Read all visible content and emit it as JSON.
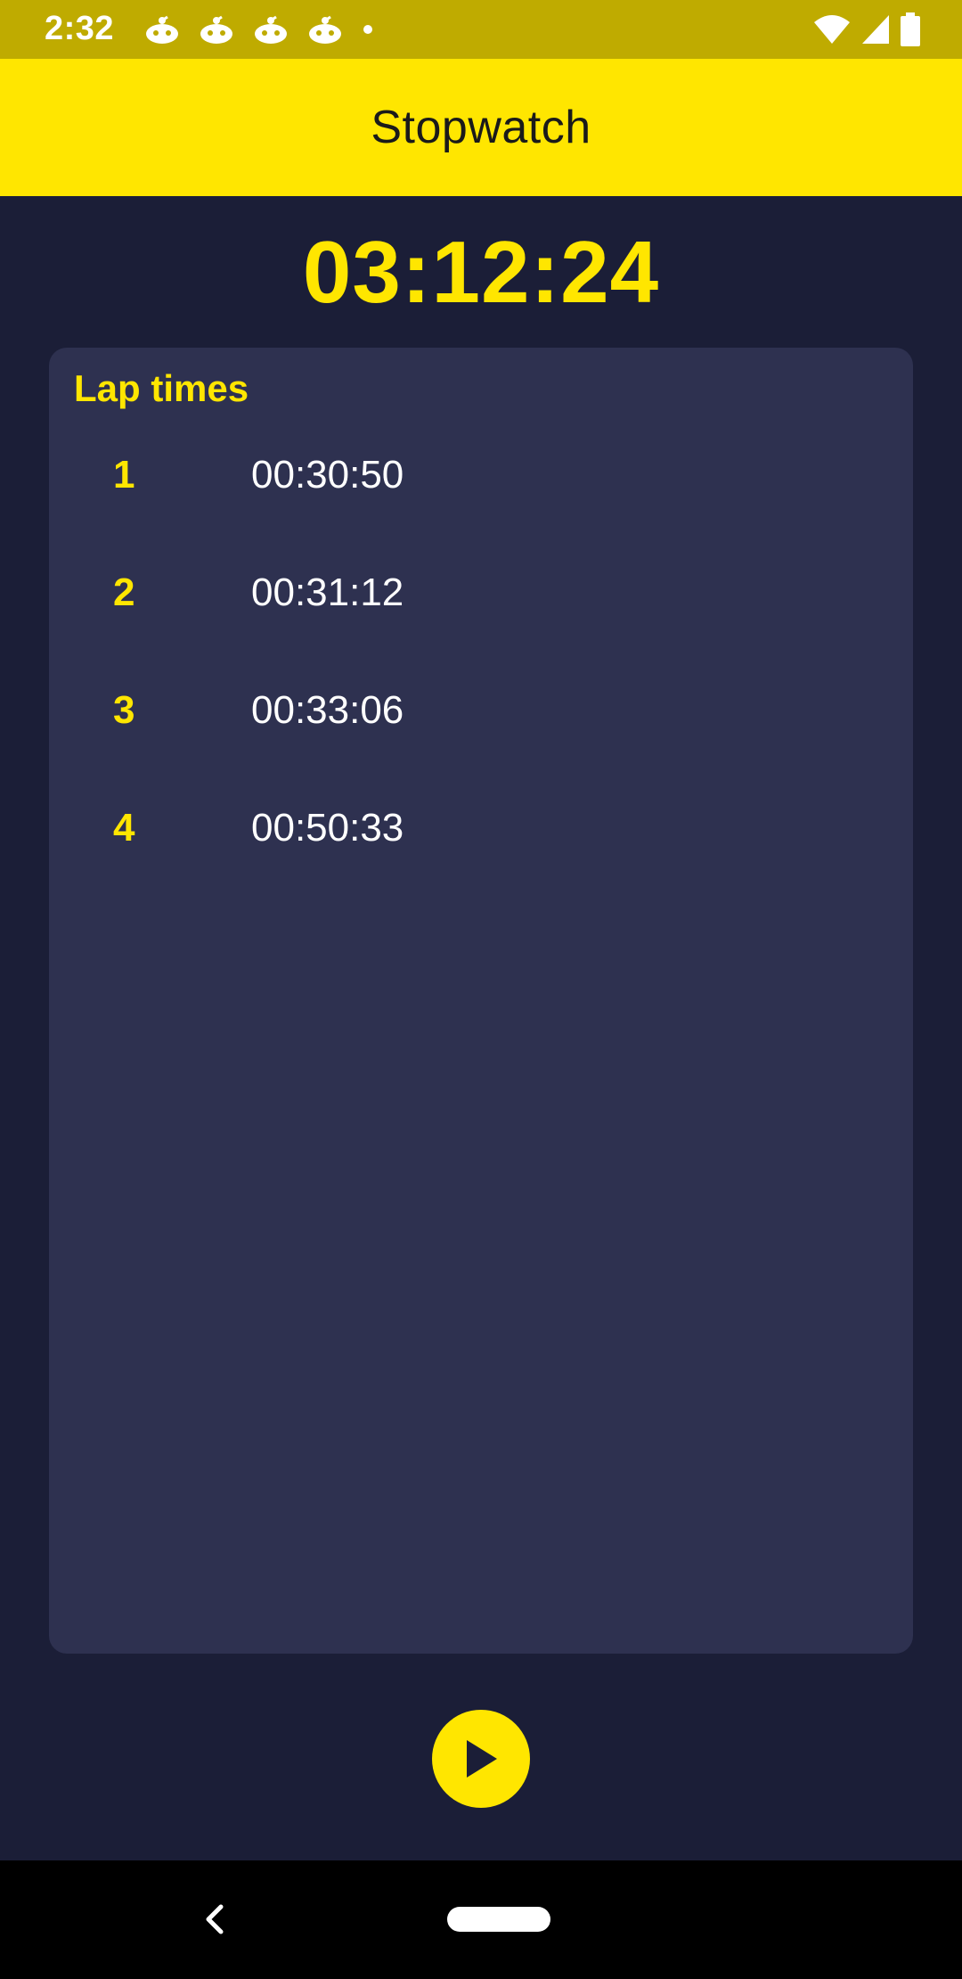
{
  "status_bar": {
    "time": "2:32",
    "notification_icons": [
      "notification-icon",
      "notification-icon",
      "notification-icon",
      "notification-icon",
      "dot-icon"
    ],
    "right_icons": [
      "wifi-icon",
      "signal-icon",
      "battery-icon"
    ]
  },
  "app_bar": {
    "title": "Stopwatch"
  },
  "timer": {
    "value": "03:12:24"
  },
  "laps": {
    "title": "Lap times",
    "items": [
      {
        "number": "1",
        "time": "00:30:50"
      },
      {
        "number": "2",
        "time": "00:31:12"
      },
      {
        "number": "3",
        "time": "00:33:06"
      },
      {
        "number": "4",
        "time": "00:50:33"
      }
    ]
  },
  "controls": {
    "play_icon": "play-icon"
  },
  "nav_bar": {
    "back_icon": "back-icon",
    "home_icon": "home-pill-icon"
  },
  "colors": {
    "accent": "#ffe600",
    "status_bar": "#bfab00",
    "background": "#1b1e37",
    "card": "#2e3150",
    "text_primary": "#ffffff"
  }
}
